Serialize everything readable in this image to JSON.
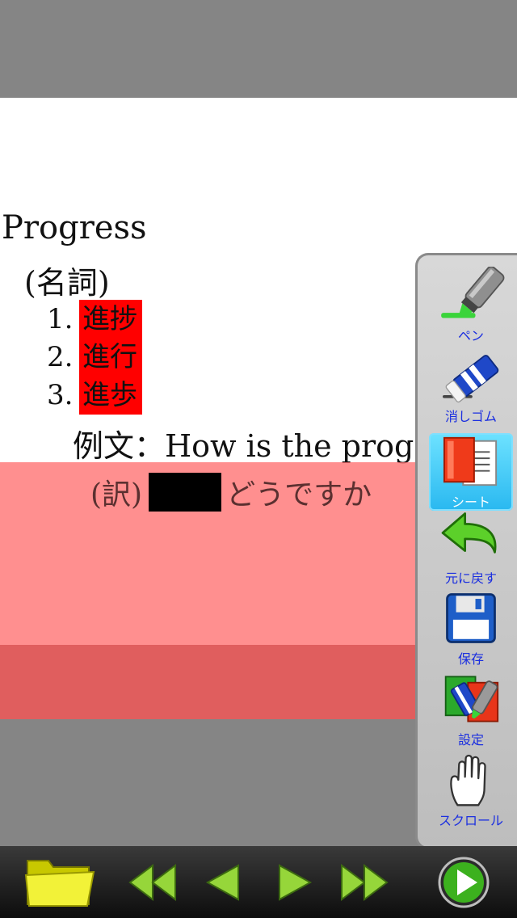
{
  "document": {
    "word": "Progress",
    "part_of_speech": "(名詞)",
    "definitions": [
      {
        "num": "1.",
        "text": "進捗"
      },
      {
        "num": "2.",
        "text": "進行"
      },
      {
        "num": "3.",
        "text": "進歩"
      }
    ],
    "example": "例文：How is the prog",
    "translation_prefix": "(訳)",
    "translation_suffix": "どうですか"
  },
  "toolbar": {
    "pen_label": "ペン",
    "eraser_label": "消しゴム",
    "sheet_label": "シート",
    "undo_label": "元に戻す",
    "save_label": "保存",
    "settings_label": "設定",
    "scroll_label": "スクロール",
    "active_tool": "sheet"
  },
  "bottom_bar": {
    "icons": [
      "folder-icon",
      "first-page-icon",
      "previous-page-icon",
      "next-page-icon",
      "last-page-icon",
      "play-icon"
    ]
  },
  "colors": {
    "highlight": "#ff0000",
    "sheet": "#ff7070",
    "tool_label": "#1a2ee0",
    "active_tool": "#29b8f0"
  }
}
